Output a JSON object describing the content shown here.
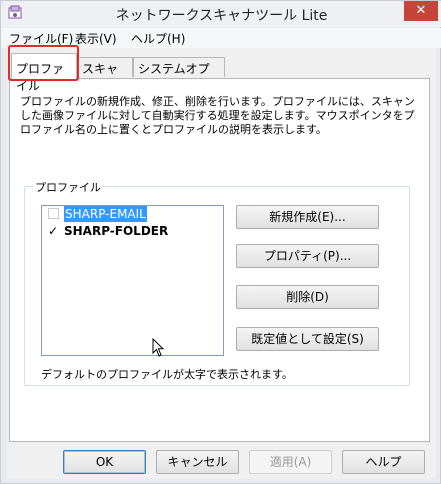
{
  "window": {
    "title": "ネットワークスキャナツール Lite",
    "close_label": "✕"
  },
  "menu": [
    {
      "label": "ファイル(F)"
    },
    {
      "label": "表示(V)"
    },
    {
      "label": "ヘルプ(H)"
    }
  ],
  "tabs": [
    {
      "label": "プロファイル",
      "active": true
    },
    {
      "label": "スキャナ",
      "active": false
    },
    {
      "label": "システムオプション",
      "active": false
    }
  ],
  "description": "プロファイルの新規作成、修正、削除を行います。プロファイルには、スキャンした画像ファイルに対して自動実行する処理を設定します。マウスポインタをプロファイル名の上に置くとプロファイルの説明を表示します。",
  "profiles_group": {
    "label": "プロファイル",
    "items": [
      {
        "label": "SHARP-EMAIL",
        "checked": false,
        "selected": true,
        "is_default": false
      },
      {
        "label": "SHARP-FOLDER",
        "checked": true,
        "selected": false,
        "is_default": true
      }
    ],
    "buttons": {
      "new": "新規作成(E)...",
      "properties": "プロパティ(P)...",
      "delete": "削除(D)",
      "set_default": "既定値として設定(S)"
    },
    "note": "デフォルトのプロファイルが太字で表示されます。"
  },
  "footer": {
    "ok": "OK",
    "cancel": "キャンセル",
    "apply": "適用(A)",
    "help": "ヘルプ"
  },
  "colors": {
    "highlight_box": "#e12b2b",
    "selection": "#3399ff",
    "close_button": "#c7443a"
  }
}
